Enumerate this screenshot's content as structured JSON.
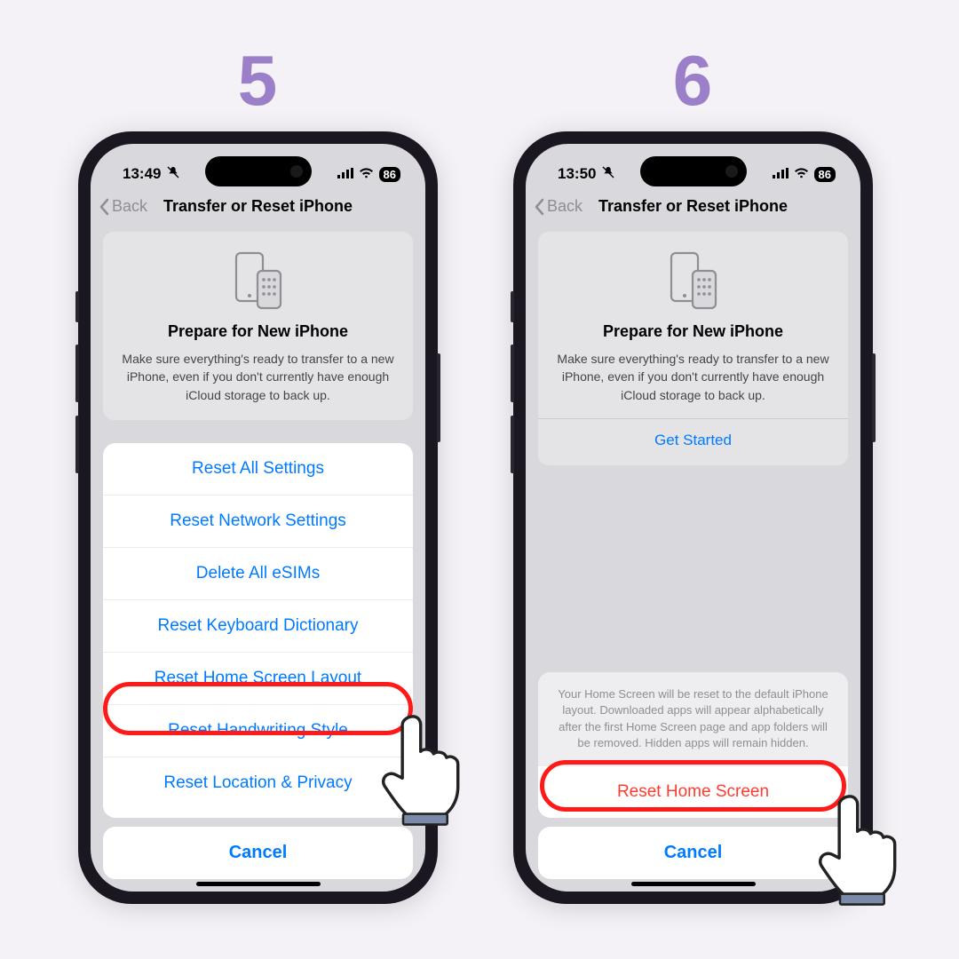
{
  "steps": {
    "left": "5",
    "right": "6"
  },
  "status": {
    "time_left": "13:49",
    "time_right": "13:50",
    "battery": "86"
  },
  "nav": {
    "back": "Back",
    "title": "Transfer or Reset iPhone"
  },
  "prepare": {
    "title": "Prepare for New iPhone",
    "desc": "Make sure everything's ready to transfer to a new iPhone, even if you don't currently have enough iCloud storage to back up.",
    "get_started": "Get Started"
  },
  "reset_sheet": {
    "items": [
      "Reset All Settings",
      "Reset Network Settings",
      "Delete All eSIMs",
      "Reset Keyboard Dictionary",
      "Reset Home Screen Layout",
      "Reset Handwriting Style",
      "Reset Location & Privacy"
    ],
    "cancel": "Cancel"
  },
  "confirm": {
    "text": "Your Home Screen will be reset to the default iPhone layout. Downloaded apps will appear alphabetically after the first Home Screen page and app folders will be removed. Hidden apps will remain hidden.",
    "action": "Reset Home Screen",
    "cancel": "Cancel"
  },
  "colors": {
    "accent_purple": "#9b7fc9",
    "ios_blue": "#007aff",
    "ios_red": "#ff3b30",
    "highlight_red": "#ff1a1a"
  }
}
